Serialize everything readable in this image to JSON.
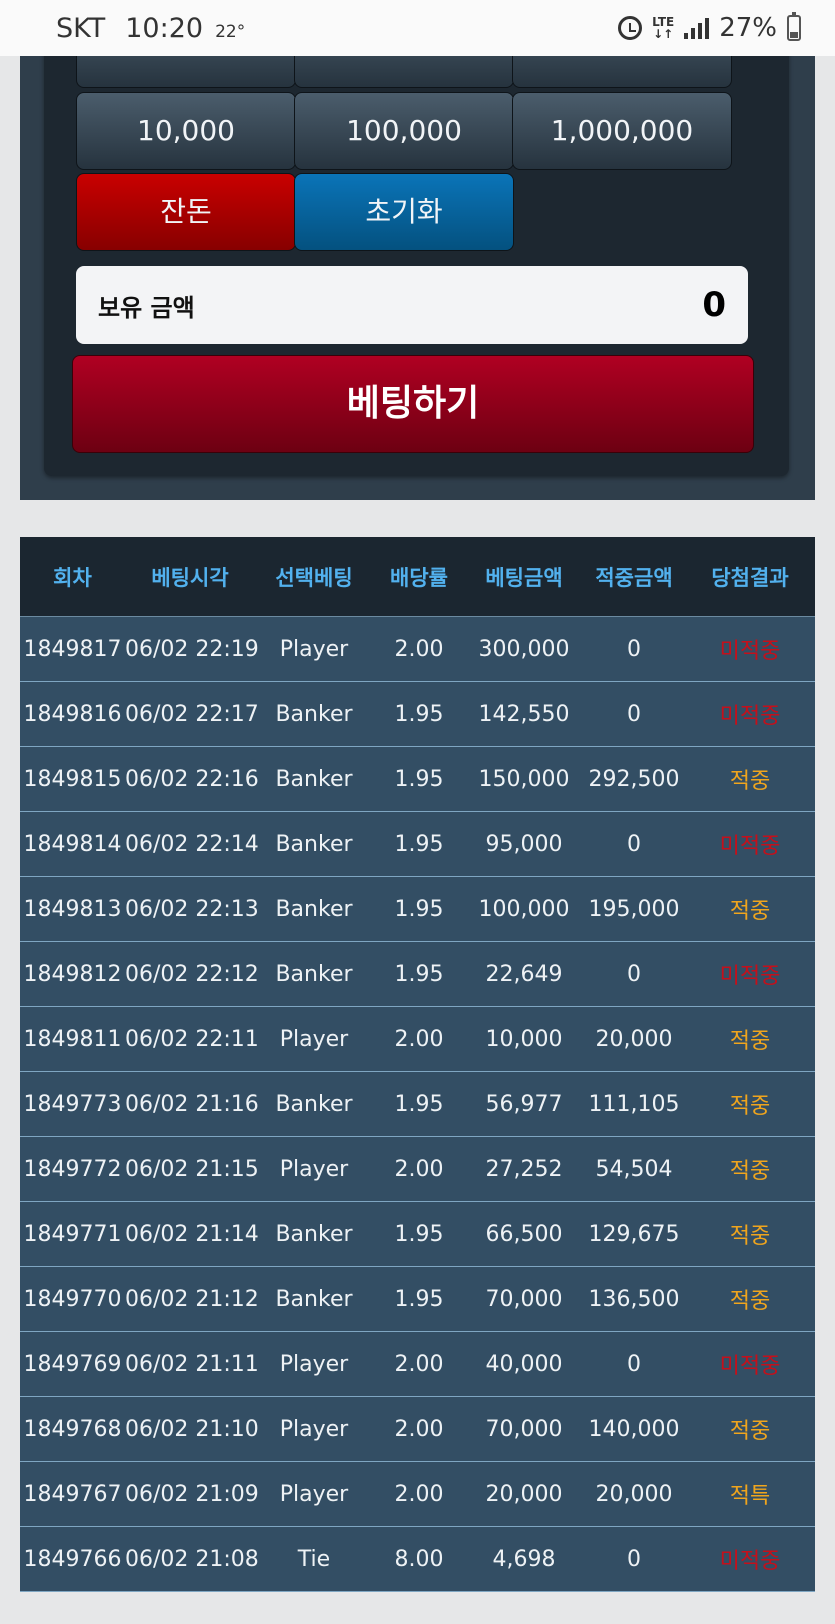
{
  "status_bar": {
    "carrier": "SKT",
    "time": "10:20",
    "temperature": "22°",
    "network": "LTE",
    "battery": "27%"
  },
  "chips": {
    "row1": [
      "10,000",
      "100,000",
      "1,000,000"
    ],
    "change_label": "잔돈",
    "reset_label": "초기화"
  },
  "balance": {
    "label": "보유 금액",
    "value": "0"
  },
  "bet_button_label": "베팅하기",
  "results_table": {
    "headers": [
      "회차",
      "베팅시각",
      "선택베팅",
      "배당률",
      "베팅금액",
      "적중금액",
      "당첨결과"
    ],
    "rows": [
      [
        "1849817",
        "06/02 22:19",
        "Player",
        "2.00",
        "300,000",
        "0",
        "미적중"
      ],
      [
        "1849816",
        "06/02 22:17",
        "Banker",
        "1.95",
        "142,550",
        "0",
        "미적중"
      ],
      [
        "1849815",
        "06/02 22:16",
        "Banker",
        "1.95",
        "150,000",
        "292,500",
        "적중"
      ],
      [
        "1849814",
        "06/02 22:14",
        "Banker",
        "1.95",
        "95,000",
        "0",
        "미적중"
      ],
      [
        "1849813",
        "06/02 22:13",
        "Banker",
        "1.95",
        "100,000",
        "195,000",
        "적중"
      ],
      [
        "1849812",
        "06/02 22:12",
        "Banker",
        "1.95",
        "22,649",
        "0",
        "미적중"
      ],
      [
        "1849811",
        "06/02 22:11",
        "Player",
        "2.00",
        "10,000",
        "20,000",
        "적중"
      ],
      [
        "1849773",
        "06/02 21:16",
        "Banker",
        "1.95",
        "56,977",
        "111,105",
        "적중"
      ],
      [
        "1849772",
        "06/02 21:15",
        "Player",
        "2.00",
        "27,252",
        "54,504",
        "적중"
      ],
      [
        "1849771",
        "06/02 21:14",
        "Banker",
        "1.95",
        "66,500",
        "129,675",
        "적중"
      ],
      [
        "1849770",
        "06/02 21:12",
        "Banker",
        "1.95",
        "70,000",
        "136,500",
        "적중"
      ],
      [
        "1849769",
        "06/02 21:11",
        "Player",
        "2.00",
        "40,000",
        "0",
        "미적중"
      ],
      [
        "1849768",
        "06/02 21:10",
        "Player",
        "2.00",
        "70,000",
        "140,000",
        "적중"
      ],
      [
        "1849767",
        "06/02 21:09",
        "Player",
        "2.00",
        "20,000",
        "20,000",
        "적특"
      ],
      [
        "1849766",
        "06/02 21:08",
        "Tie",
        "8.00",
        "4,698",
        "0",
        "미적중"
      ]
    ]
  },
  "colors": {
    "win": "#f0a51d",
    "lose": "#c4101b",
    "header_text": "#52b1ee"
  }
}
